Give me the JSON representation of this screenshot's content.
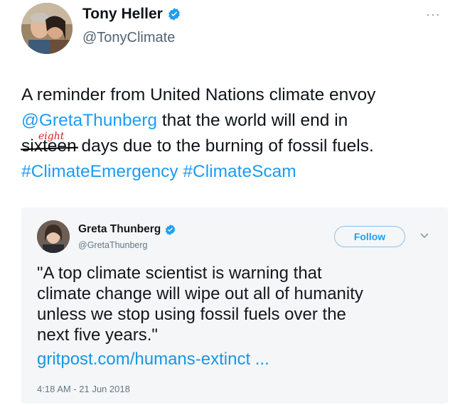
{
  "tweet": {
    "author": {
      "name": "Tony Heller",
      "handle": "@TonyClimate",
      "verified_icon": "verified-badge-icon"
    },
    "more_label": "···",
    "body": {
      "line1": "A reminder from United Nations climate envoy",
      "mention": "@GretaThunberg",
      "line2_rest": " that the world will end in",
      "struck_word": "sixteen",
      "correction": "eight",
      "line3_rest": " days due to the burning of fossil fuels.",
      "hashtag1": "#ClimateEmergency",
      "hashtag2": "#ClimateScam"
    }
  },
  "embed": {
    "author": {
      "name": "Greta Thunberg",
      "handle": "@GretaThunberg"
    },
    "follow_label": "Follow",
    "text_lines": [
      "\"A top climate scientist is warning that",
      "climate change will wipe out all of humanity",
      "unless we stop using fossil fuels over the",
      "next five years.\""
    ],
    "link": "gritpost.com/humans-extinct ...",
    "timestamp": "4:18 AM - 21 Jun 2018"
  },
  "colors": {
    "link": "#1d9bf0",
    "correction": "#d62020",
    "embed_bg": "#f4f6f8"
  }
}
